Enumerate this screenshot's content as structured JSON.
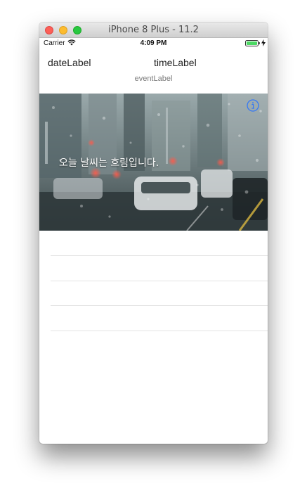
{
  "window": {
    "title": "iPhone 8 Plus - 11.2"
  },
  "status_bar": {
    "carrier": "Carrier",
    "time": "4:09 PM"
  },
  "labels": {
    "date": "dateLabel",
    "time": "timeLabel",
    "event": "eventLabel"
  },
  "weather": {
    "text": "오늘 날씨는 흐림입니다."
  },
  "table": {
    "rows": [
      "",
      "",
      "",
      ""
    ]
  },
  "colors": {
    "accent": "#3478f6",
    "close": "#fc5f57",
    "minimize": "#fdbc2e",
    "maximize": "#28c840"
  }
}
